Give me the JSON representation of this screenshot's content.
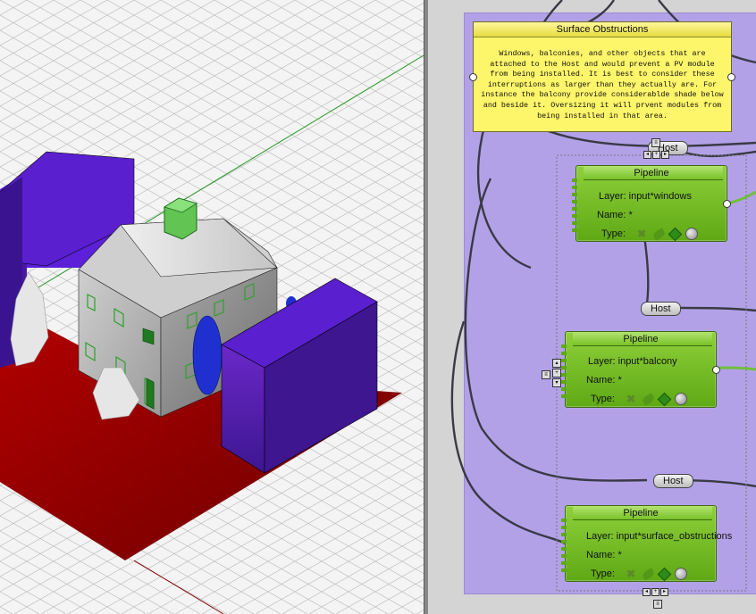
{
  "viewport": {
    "colors": {
      "ground": "#8a0000",
      "purple": "#4a1a9e",
      "white": "#e0e0e0",
      "green": "#62c452",
      "blue": "#2030d0"
    }
  },
  "canvas": {
    "note": {
      "title": "Surface Obstructions",
      "body": "Windows, balconies, and other objects that are attached to the Host and would prevent a PV module from being installed. It is best to consider these interruptions as larger than they actually are. For instance the balcony provide considerablde shade below and beside it. Oversizing it will prvent modules from being installed in that area."
    },
    "hosts": [
      {
        "label": "Host"
      },
      {
        "label": "Host"
      },
      {
        "label": "Host"
      }
    ],
    "pipelines": [
      {
        "title": "Pipeline",
        "layer": "Layer: input*windows",
        "name": "Name: *",
        "type": "Type:"
      },
      {
        "title": "Pipeline",
        "layer": "Layer: input*balcony",
        "name": "Name: *",
        "type": "Type:"
      },
      {
        "title": "Pipeline",
        "layer": "Layer: input*surface_obstructions",
        "name": "Name: *",
        "type": "Type:"
      }
    ]
  }
}
